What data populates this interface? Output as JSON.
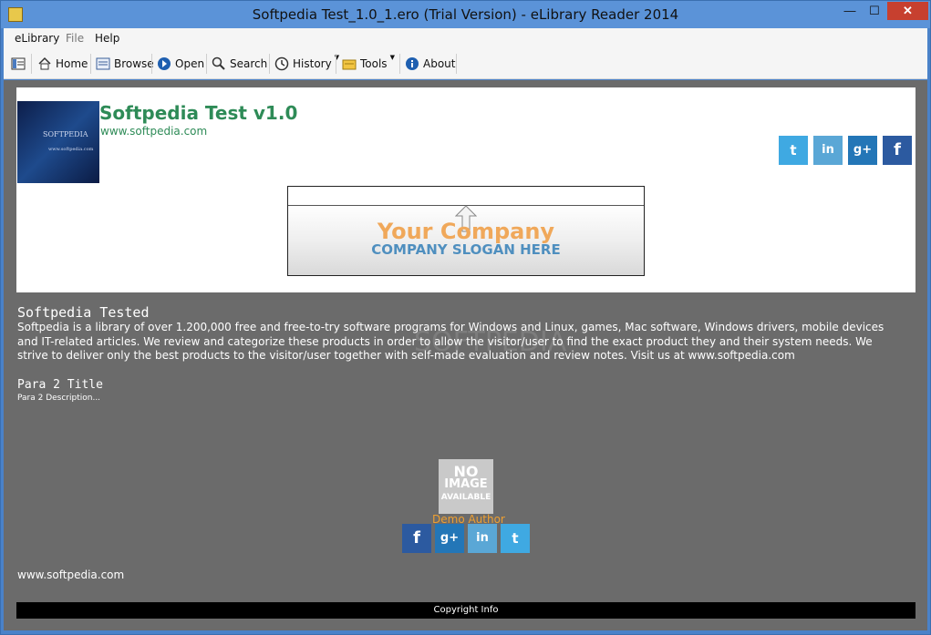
{
  "window": {
    "title": "Softpedia Test_1.0_1.ero (Trial Version) - eLibrary Reader 2014",
    "minimize": "—",
    "maximize": "☐",
    "close": "✕"
  },
  "menu": {
    "elibrary": "eLibrary",
    "file": "File",
    "help": "Help"
  },
  "toolbar": {
    "home": "Home",
    "browse": "Browse",
    "open": "Open",
    "search": "Search",
    "history": "History",
    "tools": "Tools",
    "about": "About"
  },
  "header": {
    "cover_line1": "SOFTPEDIA",
    "cover_line2": "www.softpedia.com",
    "title": "Softpedia Test v1.0",
    "url": "www.softpedia.com",
    "social_icons": [
      "twitter-icon",
      "linkedin-icon",
      "google-plus-icon",
      "facebook-icon"
    ],
    "social_labels": {
      "twitter": "t",
      "linkedin": "in",
      "gplus": "g+",
      "facebook": "f"
    }
  },
  "banner": {
    "company": "Your Company",
    "slogan": "COMPANY SLOGAN HERE"
  },
  "content": {
    "section_title": "Softpedia Tested",
    "paragraph": "Softpedia is a library of over 1.200,000 free and free-to-try software programs for Windows and Linux, games, Mac software, Windows drivers, mobile devices and IT-related articles. We review and categorize these products in order to allow the visitor/user to find the exact product they and their system needs. We strive to deliver only the best products to the visitor/user together with self-made evaluation and review notes. Visit us at www.softpedia.com",
    "para2_title": "Para 2 Title",
    "para2_desc": "Para 2 Description..."
  },
  "author": {
    "noimage_1": "NO",
    "noimage_2": "IMAGE",
    "noimage_3": "AVAILABLE",
    "name": "Demo Author"
  },
  "footer": {
    "url": "www.softpedia.com",
    "copyright": "Copyright Info"
  },
  "colors": {
    "titlebar": "#5b93d8",
    "title_green": "#2e8b57",
    "content_bg": "#6b6b6b",
    "author_orange": "#f0a030"
  }
}
